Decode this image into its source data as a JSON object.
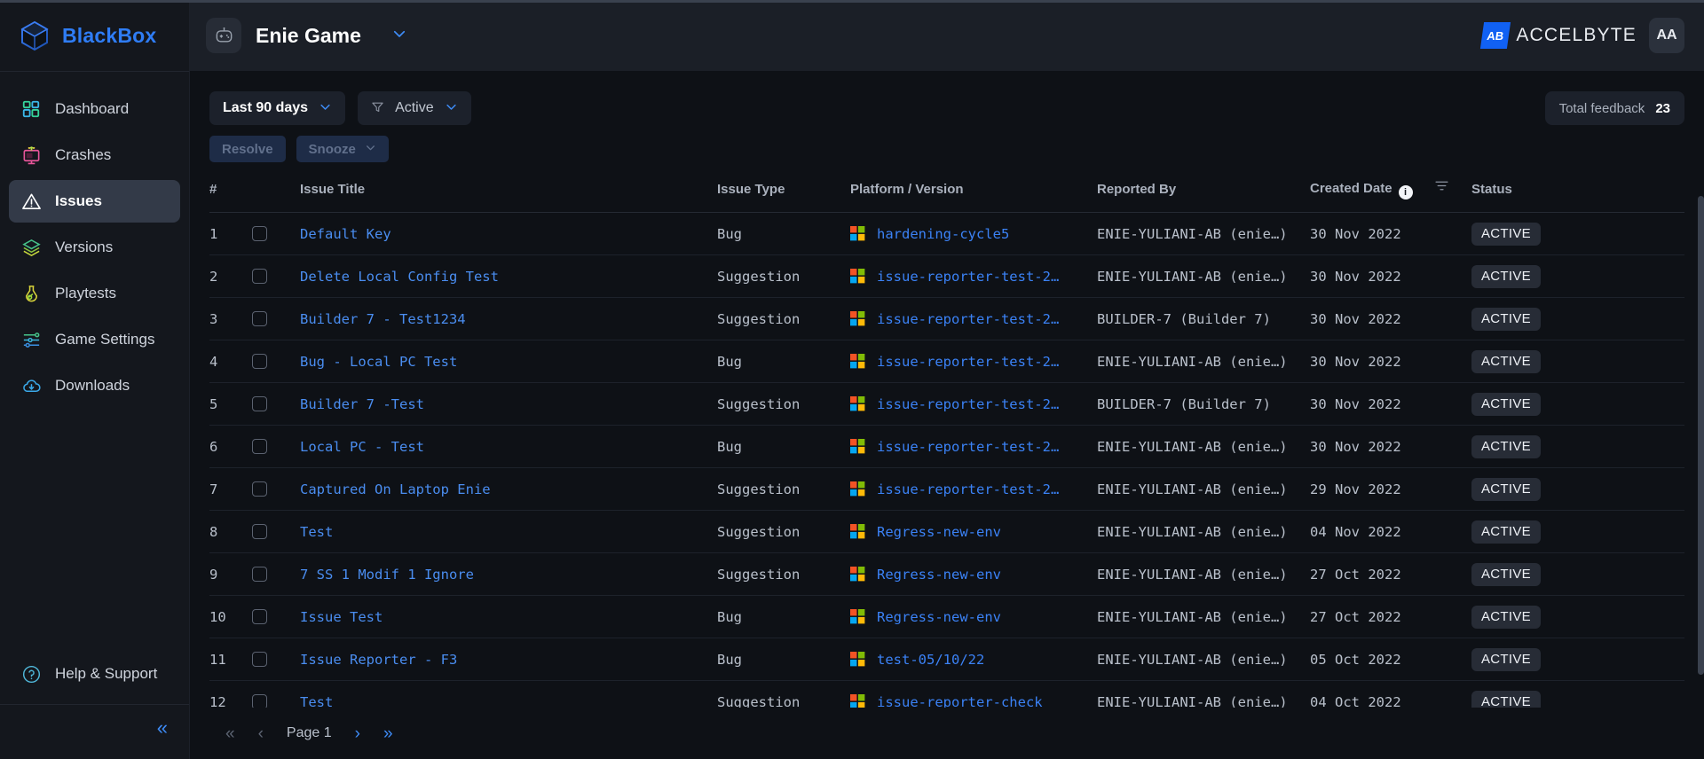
{
  "brand": {
    "name": "BlackBox",
    "logo_icon": "cube-icon"
  },
  "sidebar": {
    "items": [
      {
        "label": "Dashboard",
        "icon": "dashboard-icon",
        "active": false
      },
      {
        "label": "Crashes",
        "icon": "crashes-icon",
        "active": false
      },
      {
        "label": "Issues",
        "icon": "warning-triangle-icon",
        "active": true
      },
      {
        "label": "Versions",
        "icon": "layers-icon",
        "active": false
      },
      {
        "label": "Playtests",
        "icon": "flask-icon",
        "active": false
      },
      {
        "label": "Game Settings",
        "icon": "sliders-icon",
        "active": false
      },
      {
        "label": "Downloads",
        "icon": "cloud-download-icon",
        "active": false
      }
    ],
    "help": {
      "label": "Help & Support",
      "icon": "question-circle-icon"
    },
    "collapse_icon": "chevron-double-left-icon"
  },
  "topbar": {
    "game_title": "Enie Game",
    "game_icon": "gamepad-icon",
    "game_caret_icon": "chevron-down-icon",
    "org_name": "ACCELBYTE",
    "org_mark": "AB",
    "avatar_initials": "AA"
  },
  "filters": {
    "date_range": "Last 90 days",
    "date_caret_icon": "chevron-down-icon",
    "status_filter": "Active",
    "funnel_icon": "filter-icon",
    "status_caret_icon": "chevron-down-icon",
    "total_feedback_label": "Total feedback",
    "total_feedback_count": "23"
  },
  "actions": {
    "resolve_label": "Resolve",
    "snooze_label": "Snooze",
    "snooze_caret_icon": "chevron-down-icon"
  },
  "table": {
    "columns": {
      "num": "#",
      "title": "Issue Title",
      "type": "Issue Type",
      "platform": "Platform / Version",
      "reported_by": "Reported By",
      "created_date": "Created Date",
      "status": "Status",
      "info_icon": "info-icon",
      "sort_icon": "sort-icon"
    },
    "rows": [
      {
        "num": "1",
        "title": "Default Key",
        "type": "Bug",
        "platform": "hardening-cycle5",
        "reported_by": "ENIE-YULIANI-AB (enie…)",
        "created_date": "30 Nov 2022",
        "status": "ACTIVE"
      },
      {
        "num": "2",
        "title": "Delete Local Config Test",
        "type": "Suggestion",
        "platform": "issue-reporter-test-2…",
        "reported_by": "ENIE-YULIANI-AB (enie…)",
        "created_date": "30 Nov 2022",
        "status": "ACTIVE"
      },
      {
        "num": "3",
        "title": "Builder 7 - Test1234",
        "type": "Suggestion",
        "platform": "issue-reporter-test-2…",
        "reported_by": "BUILDER-7 (Builder 7)",
        "created_date": "30 Nov 2022",
        "status": "ACTIVE"
      },
      {
        "num": "4",
        "title": "Bug - Local PC Test",
        "type": "Bug",
        "platform": "issue-reporter-test-2…",
        "reported_by": "ENIE-YULIANI-AB (enie…)",
        "created_date": "30 Nov 2022",
        "status": "ACTIVE"
      },
      {
        "num": "5",
        "title": "Builder 7 -Test",
        "type": "Suggestion",
        "platform": "issue-reporter-test-2…",
        "reported_by": "BUILDER-7 (Builder 7)",
        "created_date": "30 Nov 2022",
        "status": "ACTIVE"
      },
      {
        "num": "6",
        "title": "Local PC - Test",
        "type": "Bug",
        "platform": "issue-reporter-test-2…",
        "reported_by": "ENIE-YULIANI-AB (enie…)",
        "created_date": "30 Nov 2022",
        "status": "ACTIVE"
      },
      {
        "num": "7",
        "title": "Captured On Laptop Enie",
        "type": "Suggestion",
        "platform": "issue-reporter-test-2…",
        "reported_by": "ENIE-YULIANI-AB (enie…)",
        "created_date": "29 Nov 2022",
        "status": "ACTIVE"
      },
      {
        "num": "8",
        "title": "Test",
        "type": "Suggestion",
        "platform": "Regress-new-env",
        "reported_by": "ENIE-YULIANI-AB (enie…)",
        "created_date": "04 Nov 2022",
        "status": "ACTIVE"
      },
      {
        "num": "9",
        "title": "7 SS 1 Modif 1 Ignore",
        "type": "Suggestion",
        "platform": "Regress-new-env",
        "reported_by": "ENIE-YULIANI-AB (enie…)",
        "created_date": "27 Oct 2022",
        "status": "ACTIVE"
      },
      {
        "num": "10",
        "title": "Issue Test",
        "type": "Bug",
        "platform": "Regress-new-env",
        "reported_by": "ENIE-YULIANI-AB (enie…)",
        "created_date": "27 Oct 2022",
        "status": "ACTIVE"
      },
      {
        "num": "11",
        "title": "Issue Reporter - F3",
        "type": "Bug",
        "platform": "test-05/10/22",
        "reported_by": "ENIE-YULIANI-AB (enie…)",
        "created_date": "05 Oct 2022",
        "status": "ACTIVE"
      },
      {
        "num": "12",
        "title": "Test",
        "type": "Suggestion",
        "platform": "issue-reporter-check",
        "reported_by": "ENIE-YULIANI-AB (enie…)",
        "created_date": "04 Oct 2022",
        "status": "ACTIVE"
      }
    ]
  },
  "pagination": {
    "first_icon": "chevron-double-left-icon",
    "prev_icon": "chevron-left-icon",
    "page_label": "Page 1",
    "next_icon": "chevron-right-icon",
    "last_icon": "chevron-double-right-icon"
  },
  "colors": {
    "accent_blue": "#3e8cf7",
    "link_blue": "#4a8df0",
    "sidebar_bg": "#14171d",
    "content_bg": "#0e1116",
    "topbar_bg": "#1b1f27",
    "active_nav": "#333a48"
  }
}
